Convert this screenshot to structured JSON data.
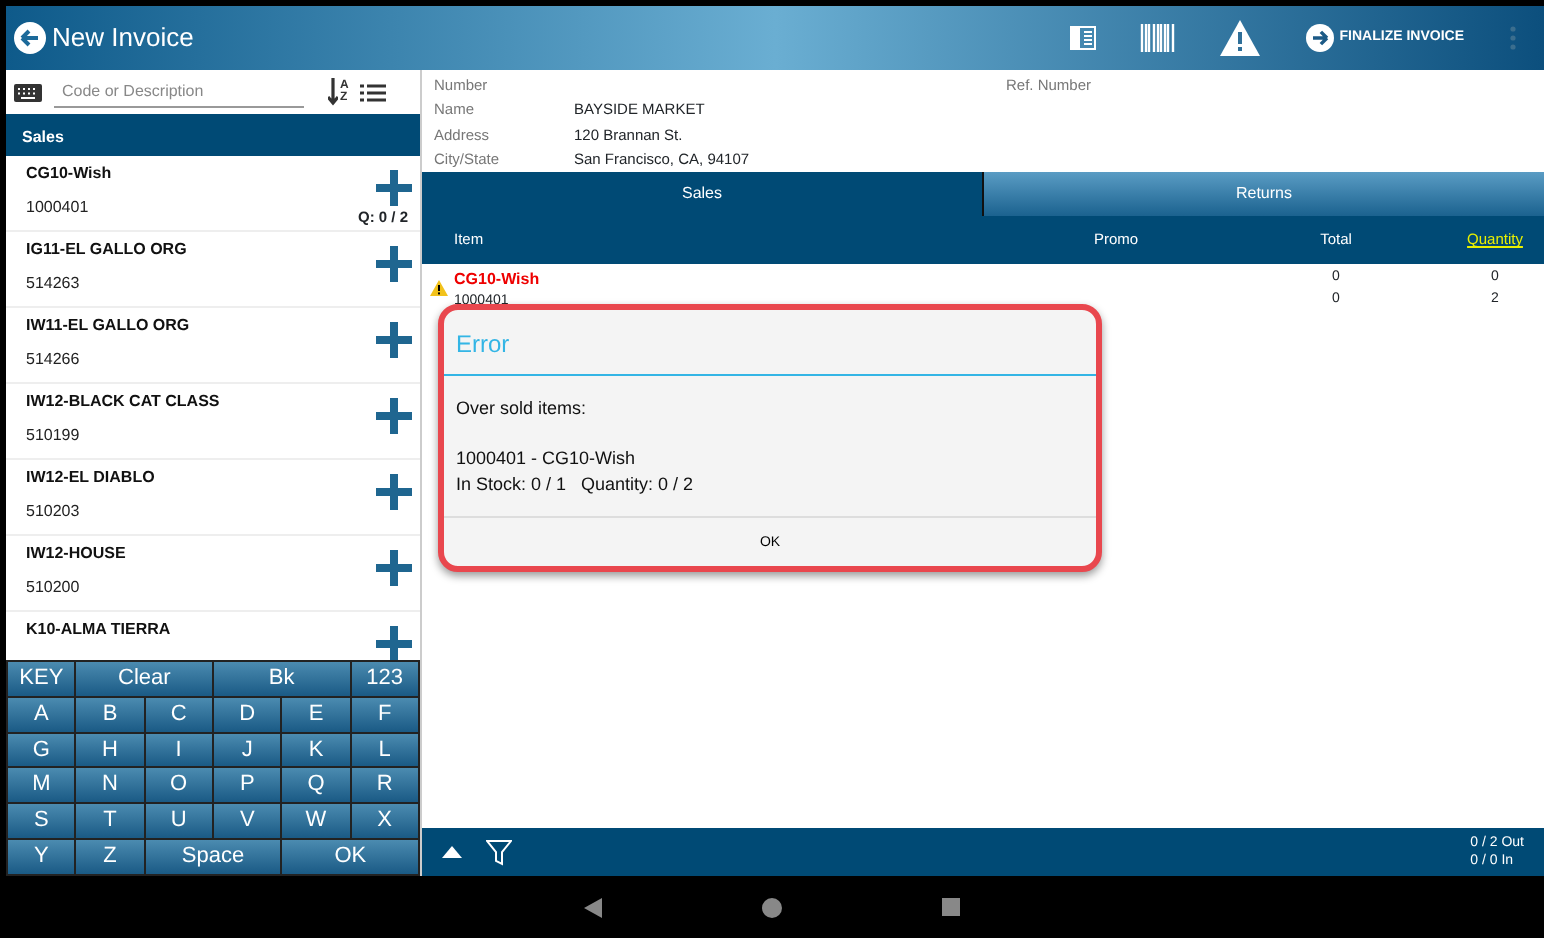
{
  "header": {
    "title": "New Invoice",
    "action": "FINALIZE INVOICE"
  },
  "search": {
    "placeholder": "Code or Description",
    "sort_letters": [
      "A",
      "Z"
    ]
  },
  "list": {
    "title": "Sales",
    "items": [
      {
        "name": "CG10-Wish",
        "code": "1000401",
        "qty": "Q: 0 / 2"
      },
      {
        "name": "IG11-EL GALLO ORG",
        "code": "514263"
      },
      {
        "name": "IW11-EL GALLO ORG",
        "code": "514266"
      },
      {
        "name": "IW12-BLACK CAT CLASS",
        "code": "510199"
      },
      {
        "name": "IW12-EL DIABLO",
        "code": "510203"
      },
      {
        "name": "IW12-HOUSE",
        "code": "510200"
      },
      {
        "name": "K10-ALMA TIERRA"
      }
    ]
  },
  "keyboard": [
    [
      {
        "label": "KEY",
        "kind": "key"
      },
      {
        "label": "Clear",
        "kind": "wide"
      },
      {
        "label": "Bk",
        "kind": "wide"
      },
      {
        "label": "123",
        "kind": "key"
      }
    ],
    [
      {
        "label": "A",
        "kind": "key"
      },
      {
        "label": "B",
        "kind": "key"
      },
      {
        "label": "C",
        "kind": "key"
      },
      {
        "label": "D",
        "kind": "key"
      },
      {
        "label": "E",
        "kind": "key"
      },
      {
        "label": "F",
        "kind": "key"
      }
    ],
    [
      {
        "label": "G",
        "kind": "key"
      },
      {
        "label": "H",
        "kind": "key"
      },
      {
        "label": "I",
        "kind": "key"
      },
      {
        "label": "J",
        "kind": "key"
      },
      {
        "label": "K",
        "kind": "key"
      },
      {
        "label": "L",
        "kind": "key"
      }
    ],
    [
      {
        "label": "M",
        "kind": "key"
      },
      {
        "label": "N",
        "kind": "key"
      },
      {
        "label": "O",
        "kind": "key"
      },
      {
        "label": "P",
        "kind": "key"
      },
      {
        "label": "Q",
        "kind": "key"
      },
      {
        "label": "R",
        "kind": "key"
      }
    ],
    [
      {
        "label": "S",
        "kind": "key"
      },
      {
        "label": "T",
        "kind": "key"
      },
      {
        "label": "U",
        "kind": "key"
      },
      {
        "label": "V",
        "kind": "key"
      },
      {
        "label": "W",
        "kind": "key"
      },
      {
        "label": "X",
        "kind": "key"
      }
    ],
    [
      {
        "label": "Y",
        "kind": "key"
      },
      {
        "label": "Z",
        "kind": "key"
      },
      {
        "label": "Space",
        "kind": "wide"
      },
      {
        "label": "OK",
        "kind": "wide"
      }
    ]
  ],
  "customer": {
    "fields": [
      {
        "label": "Number"
      },
      {
        "label": "Name",
        "value": "BAYSIDE MARKET"
      },
      {
        "label": "Address",
        "value": "120 Brannan St."
      },
      {
        "label": "City/State",
        "value": "San Francisco, CA, 94107"
      }
    ],
    "ref_label": "Ref. Number"
  },
  "tabs": [
    {
      "label": "Sales",
      "selected": true
    },
    {
      "label": "Returns",
      "selected": false
    }
  ],
  "table": {
    "columns": [
      {
        "label": "Item",
        "highlight": false
      },
      {
        "label": "Promo",
        "highlight": false
      },
      {
        "label": "Total",
        "highlight": false
      },
      {
        "label": "Quantity",
        "highlight": true
      }
    ],
    "rows": [
      {
        "name": "CG10-Wish",
        "code": "1000401",
        "warning": true,
        "totals": [
          "0",
          "0"
        ],
        "quantities": [
          "0",
          "2"
        ]
      }
    ]
  },
  "dialog": {
    "title": "Error",
    "heading": "Over sold items:",
    "lines": [
      "1000401 - CG10-Wish",
      "In Stock: 0 / 1   Quantity: 0 / 2"
    ],
    "button": "OK"
  },
  "footer": {
    "out": "0 / 2 Out",
    "in": "0 / 0 In"
  }
}
